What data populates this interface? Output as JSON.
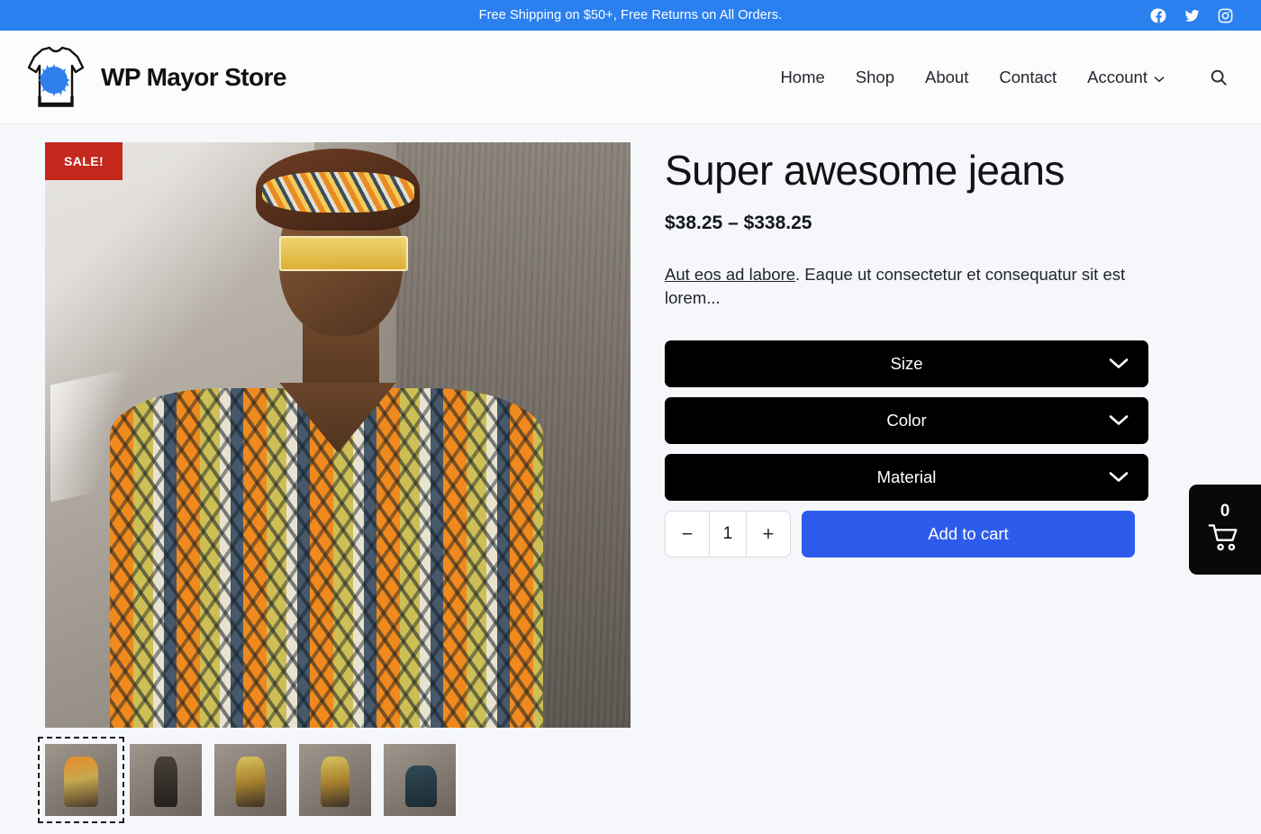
{
  "topbar": {
    "message": "Free Shipping on $50+, Free Returns on All Orders.",
    "socials": [
      {
        "name": "facebook-icon",
        "label": "Facebook"
      },
      {
        "name": "twitter-icon",
        "label": "Twitter"
      },
      {
        "name": "instagram-icon",
        "label": "Instagram"
      }
    ],
    "bg_color": "#2b80ef"
  },
  "header": {
    "logo_icon": "tshirt-splat-logo-icon",
    "brand_name": "WP Mayor Store",
    "nav": [
      {
        "label": "Home",
        "has_caret": false
      },
      {
        "label": "Shop",
        "has_caret": false
      },
      {
        "label": "About",
        "has_caret": false
      },
      {
        "label": "Contact",
        "has_caret": false
      },
      {
        "label": "Account",
        "has_caret": true
      }
    ],
    "search_icon": "search-icon"
  },
  "gallery": {
    "sale_badge": "SALE!",
    "main_image_alt": "Man in orange patterned shirt and headband leaning on concrete wall",
    "thumbnails": [
      {
        "alt": "Model close-up in orange patterned shirt",
        "selected": true
      },
      {
        "alt": "Model in dark outfit by doorway",
        "selected": false
      },
      {
        "alt": "Model in yellow patterned outfit",
        "selected": false
      },
      {
        "alt": "Model in yellow patterned outfit second view",
        "selected": false
      },
      {
        "alt": "Model seated on stairs",
        "selected": false
      }
    ]
  },
  "product": {
    "title": "Super awesome jeans",
    "price_min": "$38.25",
    "price_separator": "–",
    "price_max": "$338.25",
    "price_range": "$38.25 – $338.25",
    "description_link": "Aut eos ad labore",
    "description_rest": ". Eaque ut consectetur et consequatur sit est lorem...",
    "variations": [
      {
        "label": "Size",
        "icon": "chevron-down-icon"
      },
      {
        "label": "Color",
        "icon": "chevron-down-icon"
      },
      {
        "label": "Material",
        "icon": "chevron-down-icon"
      }
    ],
    "quantity": {
      "decrease_label": "−",
      "value": "1",
      "increase_label": "+"
    },
    "add_to_cart_label": "Add to cart",
    "accent_color": "#2d5ced",
    "sale_color": "#c4271c"
  },
  "cart_widget": {
    "count": "0",
    "icon": "shopping-cart-icon"
  }
}
